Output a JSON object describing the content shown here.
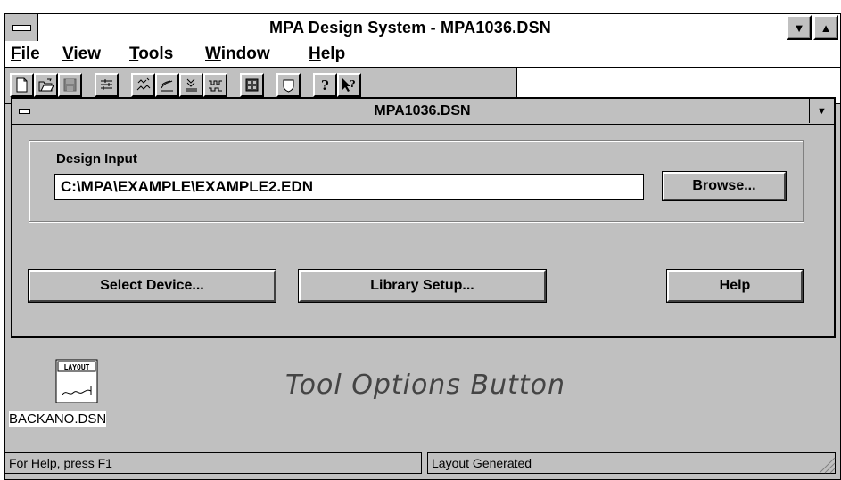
{
  "window": {
    "title": "MPA Design System - MPA1036.DSN",
    "minimize_glyph": "▼",
    "maximize_glyph": "▲"
  },
  "menu": {
    "items": [
      {
        "label": "File",
        "mnemonic": "F",
        "rest": "ile"
      },
      {
        "label": "View",
        "mnemonic": "V",
        "rest": "iew"
      },
      {
        "label": "Tools",
        "mnemonic": "T",
        "rest": "ools"
      },
      {
        "label": "Window",
        "mnemonic": "W",
        "rest": "indow"
      },
      {
        "label": "Help",
        "mnemonic": "H",
        "rest": "elp"
      }
    ]
  },
  "toolbar": {
    "icons": [
      "new-file-icon",
      "open-folder-icon",
      "save-disk-icon",
      "tool-options-icon",
      "tool-a-icon",
      "tool-b-icon",
      "tool-c-icon",
      "tool-d-icon",
      "grid-view-icon",
      "shield-icon",
      "help-question-icon",
      "context-help-icon"
    ]
  },
  "child": {
    "title": "MPA1036.DSN",
    "design_input": {
      "label": "Design Input",
      "value": "C:\\MPA\\EXAMPLE\\EXAMPLE2.EDN"
    },
    "browse_label": "Browse...",
    "select_device_label": "Select Device...",
    "library_setup_label": "Library Setup...",
    "help_label": "Help"
  },
  "desktop": {
    "icon_badge": "LAYOUT",
    "icon_label": "BACKANO.DSN"
  },
  "callout": {
    "text": "Tool Options Button"
  },
  "status": {
    "left": "For Help, press F1",
    "right": "Layout Generated"
  },
  "colors": {
    "face": "#c0c0c0",
    "highlight": "#ffffff",
    "shadow": "#808080"
  }
}
